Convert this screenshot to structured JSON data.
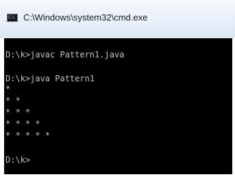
{
  "window": {
    "title": "C:\\Windows\\system32\\cmd.exe",
    "app_icon_label": "C:\\",
    "app_icon": "cmd-icon"
  },
  "console": {
    "lines": [
      "D:\\k>javac Pattern1.java",
      "D:\\k>java Pattern1",
      "*",
      "* *",
      "* * *",
      "* * * *",
      "* * * * *",
      "D:\\k>"
    ]
  },
  "colors": {
    "console_background": "#000000",
    "console_text": "#c0c0c0",
    "titlebar": "#e6eef7"
  }
}
